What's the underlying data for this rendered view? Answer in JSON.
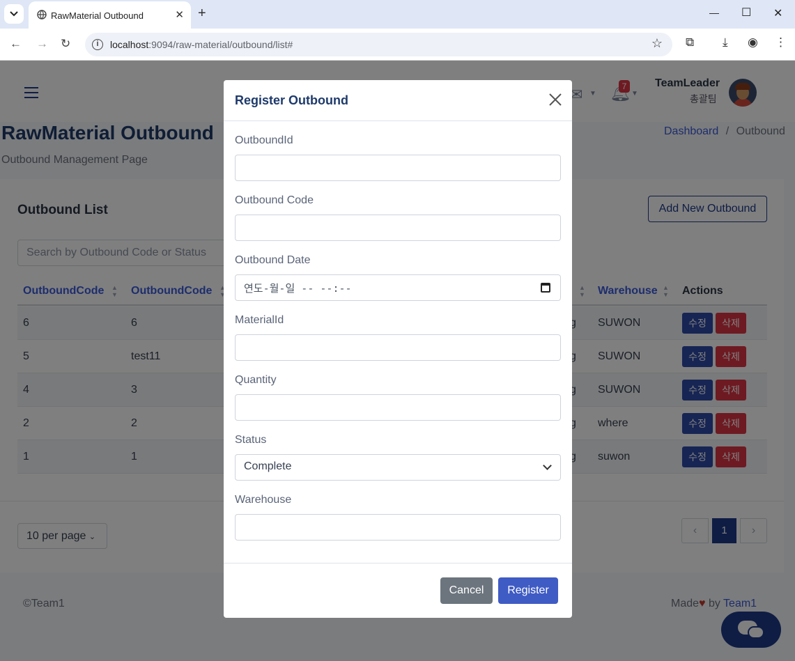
{
  "browser": {
    "tab_title": "RawMaterial Outbound",
    "url_host": "localhost",
    "url_path": ":9094/raw-material/outbound/list#",
    "icons": [
      "tab-list-icon",
      "favicon-icon",
      "tab-close-icon",
      "new-tab-icon",
      "minimize-icon",
      "maximize-icon",
      "window-close-icon",
      "back-icon",
      "forward-icon",
      "reload-icon",
      "site-info-icon",
      "bookmark-star-icon",
      "extensions-icon",
      "download-icon",
      "profile-icon",
      "menu-dots-icon"
    ]
  },
  "header": {
    "notification_count": "7",
    "user_name": "TeamLeader",
    "user_team": "총괄팀"
  },
  "page": {
    "title": "RawMaterial Outbound",
    "subtitle": "Outbound Management Page",
    "breadcrumb": {
      "home": "Dashboard",
      "separator": "/",
      "current": "Outbound"
    }
  },
  "list": {
    "title": "Outbound List",
    "add_button": "Add New Outbound",
    "search_placeholder": "Search by Outbound Code or Status",
    "columns": {
      "col1": "OutboundCode",
      "col2": "OutboundCode",
      "warehouse": "Warehouse",
      "actions": "Actions"
    },
    "rows": [
      {
        "c1": "6",
        "c2": "6",
        "c3": "g",
        "warehouse": "SUWON"
      },
      {
        "c1": "5",
        "c2": "test11",
        "c3": "g",
        "warehouse": "SUWON"
      },
      {
        "c1": "4",
        "c2": "3",
        "c3": "g",
        "warehouse": "SUWON"
      },
      {
        "c1": "2",
        "c2": "2",
        "c3": "g",
        "warehouse": "where"
      },
      {
        "c1": "1",
        "c2": "1",
        "c3": "g",
        "warehouse": "suwon"
      }
    ],
    "edit_label": "수정",
    "delete_label": "삭제",
    "per_page": "10 per page",
    "current_page": "1"
  },
  "footer": {
    "copyright": "©Team1",
    "made_prefix": "Made",
    "made_by": "by",
    "team": "Team1"
  },
  "modal": {
    "title": "Register Outbound",
    "fields": {
      "outbound_id": {
        "label": "OutboundId",
        "value": ""
      },
      "outbound_code": {
        "label": "Outbound Code",
        "value": ""
      },
      "outbound_date": {
        "label": "Outbound Date",
        "value": "연도-월-일 -- --:--"
      },
      "material_id": {
        "label": "MaterialId",
        "value": ""
      },
      "quantity": {
        "label": "Quantity",
        "value": ""
      },
      "status": {
        "label": "Status",
        "value": "Complete"
      },
      "warehouse": {
        "label": "Warehouse",
        "value": ""
      }
    },
    "cancel": "Cancel",
    "register": "Register"
  },
  "colors": {
    "primary": "#1e3a8a",
    "danger": "#dc3545",
    "secondary": "#6c757d",
    "register": "#3f5bc4"
  }
}
